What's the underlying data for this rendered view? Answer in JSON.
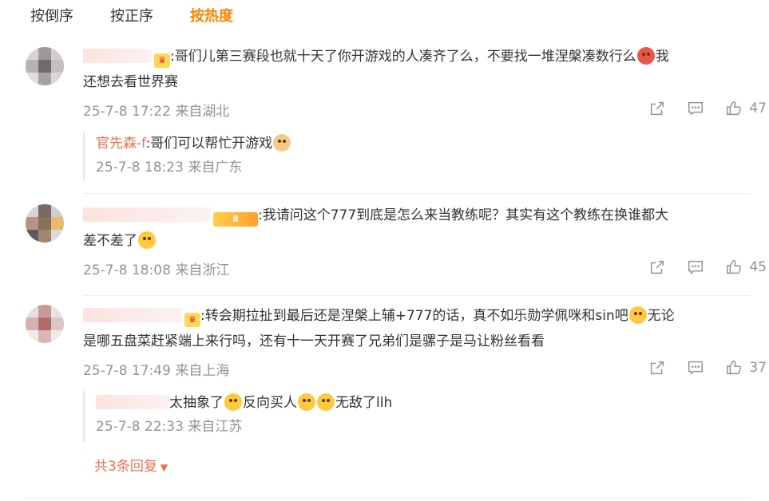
{
  "sort_tabs": [
    {
      "label": "按倒序"
    },
    {
      "label": "按正序"
    },
    {
      "label": "按热度"
    }
  ],
  "comments": [
    {
      "text_a": ":哥们儿第三赛段也就十天了你开游戏的人凑齐了么，不要找一堆涅槃凑数行么",
      "text_b": "我",
      "text_c": "还想去看世界赛",
      "time": "25-7-8 17:22 来自湖北",
      "likes": "47",
      "reply": {
        "author": "官先森-f",
        "text": ":哥们可以帮忙开游戏",
        "time": "25-7-8 18:23 来自广东"
      }
    },
    {
      "badge": "Ⅱ",
      "text_a": ":我请问这个777到底是怎么来当教练呢？其实有这个教练在换谁都大",
      "text_b": "差不差了",
      "time": "25-7-8 18:08 来自浙江",
      "likes": "45"
    },
    {
      "text_a": ":转会期拉扯到最后还是涅槃上辅+777的话，真不如乐勋学佩咪和sin吧",
      "text_b": "无论",
      "text_c": "是哪五盘菜赶紧端上来行吗，还有十一天开赛了兄弟们是骡子是马让粉丝看看",
      "time": "25-7-8 17:49 来自上海",
      "likes": "37",
      "reply": {
        "text_a": "太抽象了",
        "text_b": "反向买人",
        "text_c": "无敌了llh",
        "time": "25-7-8 22:33 来自江苏"
      },
      "more_replies": "共3条回复"
    }
  ],
  "colors": {
    "accent": "#ff8200",
    "link": "#eb7350",
    "meta": "#939393"
  }
}
